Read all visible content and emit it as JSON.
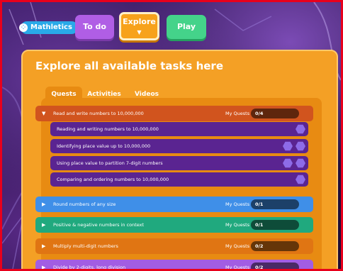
{
  "nav": {
    "logo": "Mathletics",
    "todo": "To do",
    "explore": "Explore",
    "play": "Play"
  },
  "panel": {
    "title": "Explore all available tasks here",
    "tabs": [
      "Quests",
      "Activities",
      "Videos"
    ]
  },
  "quests": [
    {
      "label": "Read and write numbers to 10,000,000",
      "my_quests_label": "My Quests",
      "progress": "0/4",
      "expanded": true,
      "color": "#d1541e",
      "subtasks": [
        {
          "label": "Reading and writing numbers to 10,000,000"
        },
        {
          "label": "Identifying place value up to 10,000,000"
        },
        {
          "label": "Using place value to partition 7-digit numbers"
        },
        {
          "label": "Comparing and ordering numbers to 10,000,000"
        }
      ]
    },
    {
      "label": "Round numbers of any size",
      "my_quests_label": "My Quests",
      "progress": "0/1",
      "color": "#3f8fe8"
    },
    {
      "label": "Positive & negative numbers in context",
      "my_quests_label": "My Quests",
      "progress": "0/1",
      "color": "#20a97e"
    },
    {
      "label": "Multiply multi-digit numbers",
      "my_quests_label": "My Quests",
      "progress": "0/2",
      "color": "#e07513"
    },
    {
      "label": "Divide by 2-digits, long division",
      "my_quests_label": "My Quests",
      "progress": "0/2",
      "color": "#a25de3"
    }
  ]
}
